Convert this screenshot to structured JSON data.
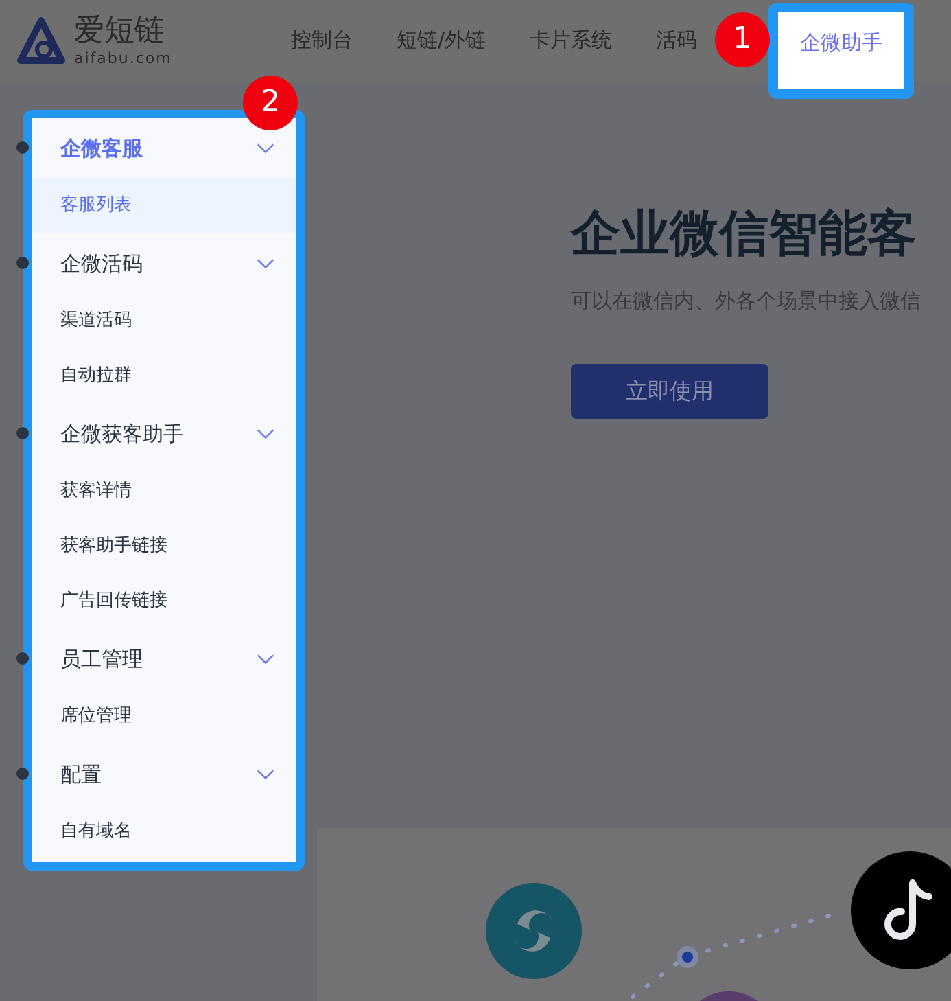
{
  "logo": {
    "name": "爱短链",
    "domain": "aifabu.com"
  },
  "nav": [
    {
      "label": "控制台",
      "selected": false
    },
    {
      "label": "短链/外链",
      "selected": false
    },
    {
      "label": "卡片系统",
      "selected": false
    },
    {
      "label": "活码",
      "selected": false
    },
    {
      "label": "企微助手",
      "selected": true
    }
  ],
  "callouts": [
    "1",
    "2"
  ],
  "menu": [
    {
      "label": "企微客服",
      "selected": true,
      "expanded": true,
      "children": [
        {
          "label": "客服列表",
          "selected": true
        }
      ]
    },
    {
      "label": "企微活码",
      "selected": false,
      "expanded": true,
      "children": [
        {
          "label": "渠道活码",
          "selected": false
        },
        {
          "label": "自动拉群",
          "selected": false
        }
      ]
    },
    {
      "label": "企微获客助手",
      "selected": false,
      "expanded": true,
      "children": [
        {
          "label": "获客详情",
          "selected": false
        },
        {
          "label": "获客助手链接",
          "selected": false
        },
        {
          "label": "广告回传链接",
          "selected": false
        }
      ]
    },
    {
      "label": "员工管理",
      "selected": false,
      "expanded": true,
      "children": [
        {
          "label": "席位管理",
          "selected": false
        }
      ]
    },
    {
      "label": "配置",
      "selected": false,
      "expanded": true,
      "children": [
        {
          "label": "自有域名",
          "selected": false
        }
      ]
    }
  ],
  "hero": {
    "title": "企业微信智能客",
    "subtitle": "可以在微信内、外各个场景中接入微信",
    "button": "立即使用"
  }
}
